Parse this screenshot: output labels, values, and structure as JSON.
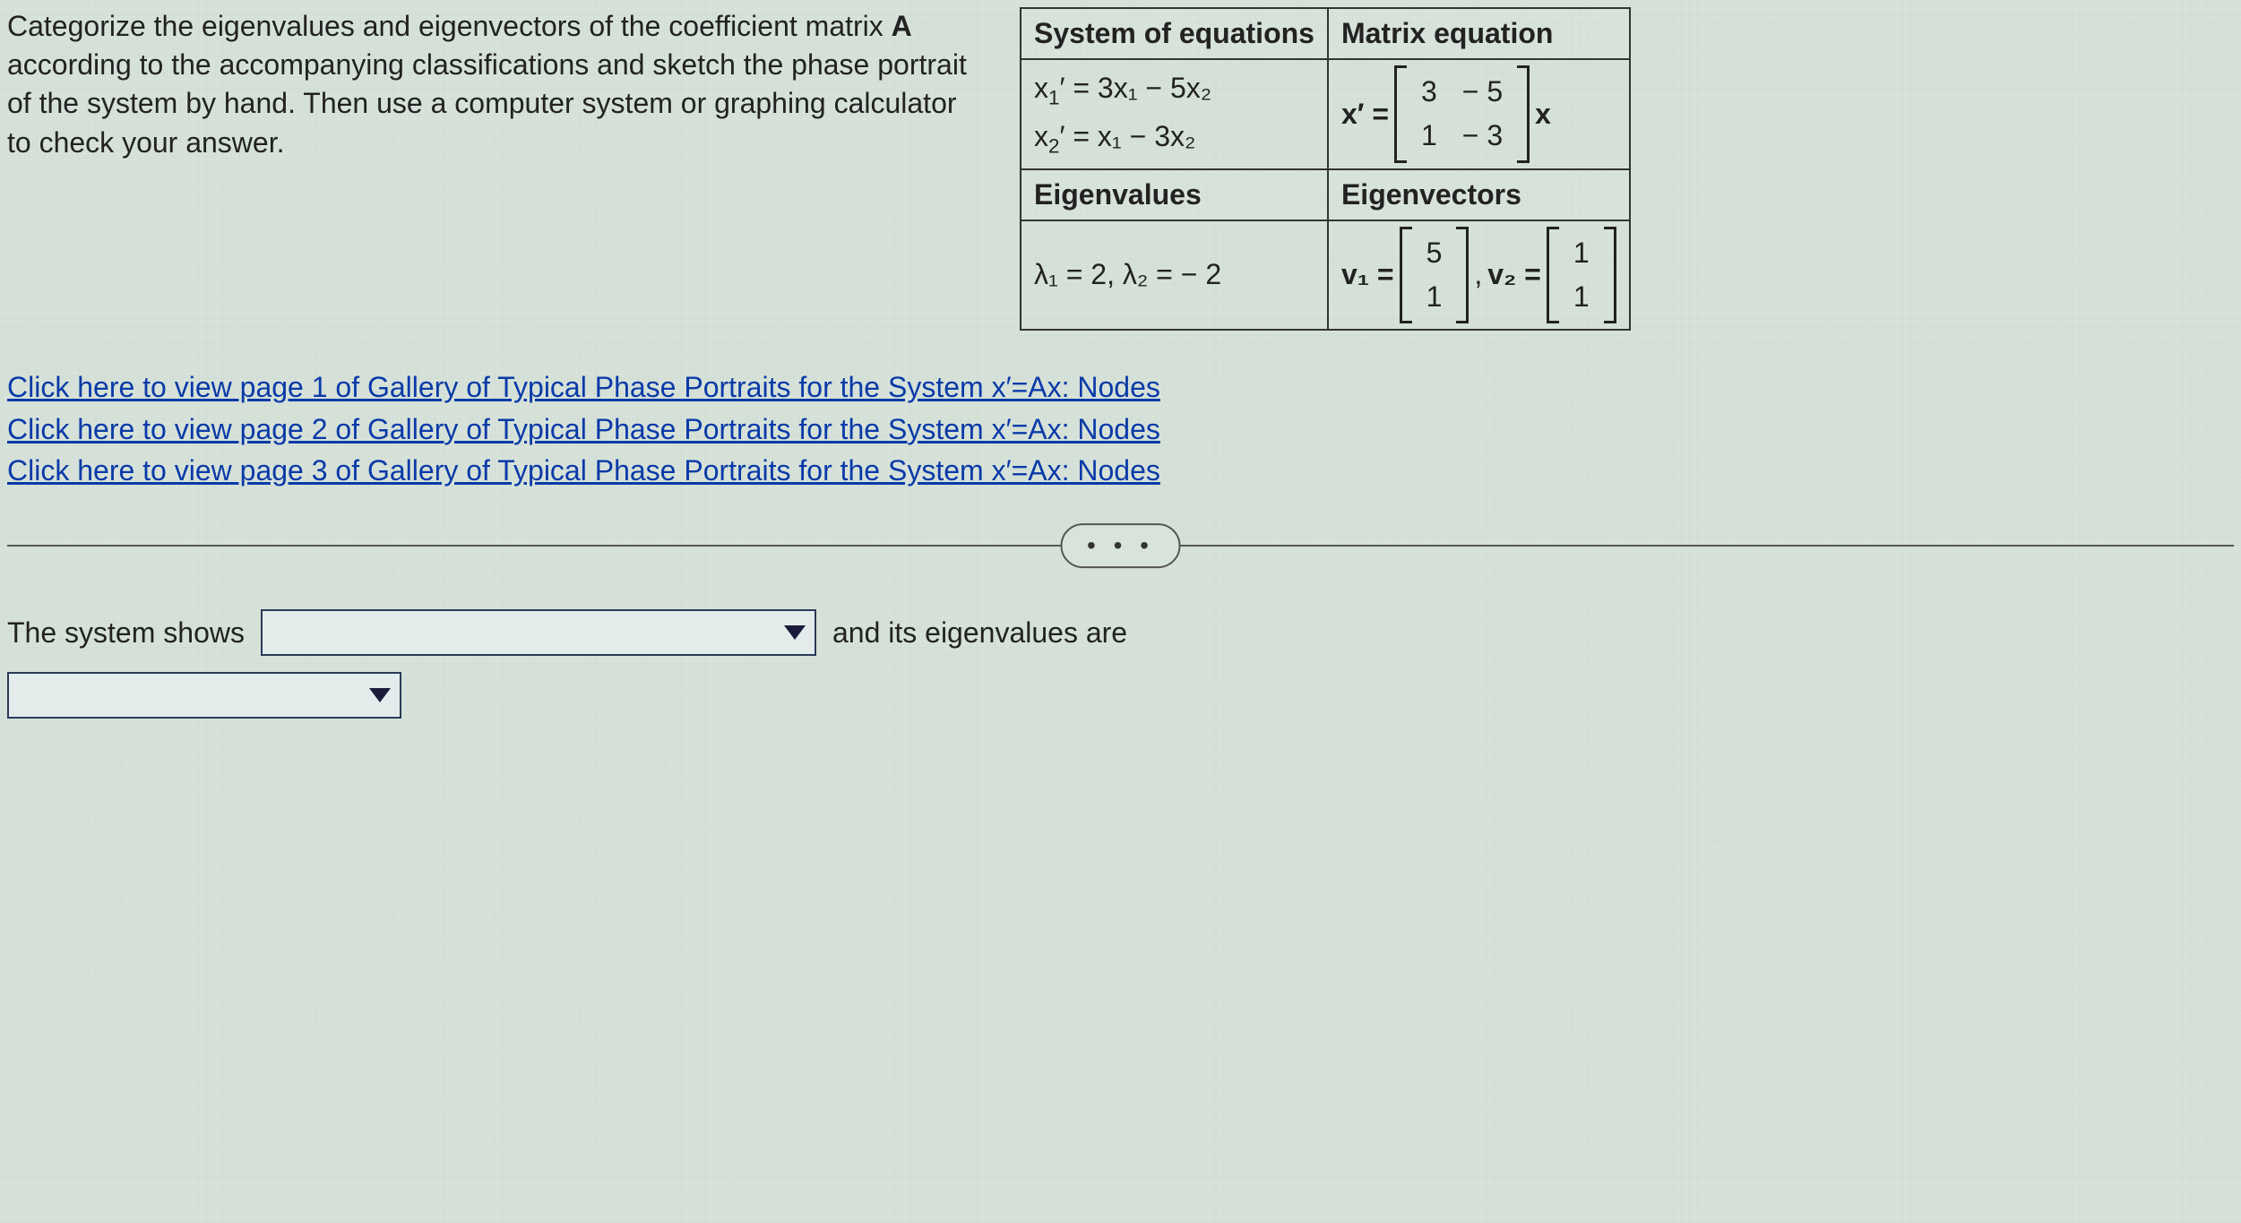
{
  "prompt": {
    "text_before_A": "Categorize the eigenvalues and eigenvectors of the coefficient matrix ",
    "bold_A": "A",
    "text_after_A": " according to the accompanying classifications and sketch the phase portrait of the system by hand. Then use a computer system or graphing calculator to check your answer."
  },
  "table": {
    "headers": {
      "system": "System of equations",
      "matrix": "Matrix equation",
      "eigvals": "Eigenvalues",
      "eigvecs": "Eigenvectors"
    },
    "system": {
      "eq1_lhs_sub": "1",
      "eq1": "x",
      "eq1_rhs": "′ = 3x₁ − 5x₂",
      "eq2_lhs_sub": "2",
      "eq2": "x",
      "eq2_rhs": "′ = x₁ − 3x₂"
    },
    "matrix_eq": {
      "lhs": "x′ =",
      "m00": "3",
      "m01": "− 5",
      "m10": "1",
      "m11": "− 3",
      "rhs": "x"
    },
    "eigenvalues": "λ₁ = 2, λ₂ = − 2",
    "eigenvectors": {
      "v1_label": "v₁ =",
      "v1_0": "5",
      "v1_1": "1",
      "sep": ", ",
      "v2_label": "v₂ =",
      "v2_0": "1",
      "v2_1": "1"
    }
  },
  "links": {
    "l1": "Click here to view page 1 of Gallery of Typical Phase Portraits for the System x′=Ax: Nodes",
    "l2": "Click here to view page 2 of Gallery of Typical Phase Portraits for the System x′=Ax: Nodes",
    "l3": "Click here to view page 3 of Gallery of Typical Phase Portraits for the System x′=Ax: Nodes"
  },
  "dots": "• • •",
  "answer": {
    "prefix": "The system shows",
    "mid": "and its eigenvalues are",
    "dropdown1_value": "",
    "dropdown2_value": ""
  }
}
